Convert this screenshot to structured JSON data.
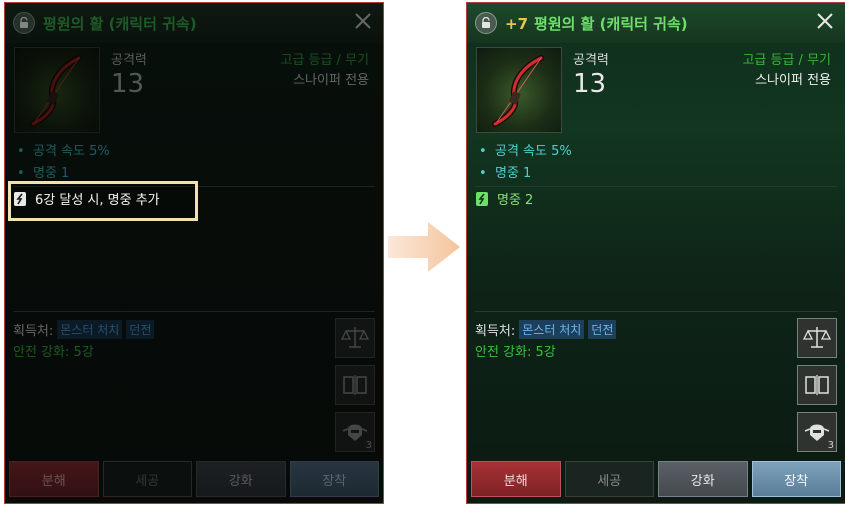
{
  "before": {
    "title": "평원의 활 (캐릭터 귀속)",
    "stat_label": "공격력",
    "stat_value": "13",
    "grade": "고급 등급 / 무기",
    "exclusive": "스나이퍼 전용",
    "options": [
      "공격 속도  5%",
      "명중  1"
    ],
    "set_effect": "6강 달성 시, 명중 추가",
    "acquire_label": "획득처:",
    "acquire_tags": [
      "몬스터 처치",
      "던전"
    ],
    "safe_enhance": "안전 강화: 5강",
    "side_count": "3",
    "buttons": [
      "분해",
      "세공",
      "강화",
      "장착"
    ]
  },
  "after": {
    "enhance_level": "+7",
    "title": "평원의 활 (캐릭터 귀속)",
    "stat_label": "공격력",
    "stat_value": "13",
    "grade": "고급 등급 / 무기",
    "exclusive": "스나이퍼 전용",
    "options": [
      "공격 속도  5%",
      "명중  1"
    ],
    "set_effect": "명중  2",
    "acquire_label": "획득처:",
    "acquire_tags": [
      "몬스터 처치",
      "던전"
    ],
    "safe_enhance": "안전 강화: 5강",
    "side_count": "3",
    "buttons": [
      "분해",
      "세공",
      "강화",
      "장착"
    ]
  },
  "icons": {
    "lock": "unlock-icon",
    "close": "close-icon",
    "arrow": "arrow-right-icon",
    "side": [
      "scale-icon",
      "card-swap-icon",
      "helmet-icon"
    ]
  },
  "colors": {
    "highlight_border": "#f3e2b0",
    "panel_border": "#b23a3a",
    "title_green": "#6ee06a",
    "enhance_gold": "#e8c84a",
    "option_cyan": "#4cd0d0",
    "arrow_color": "#f7d2b0"
  }
}
